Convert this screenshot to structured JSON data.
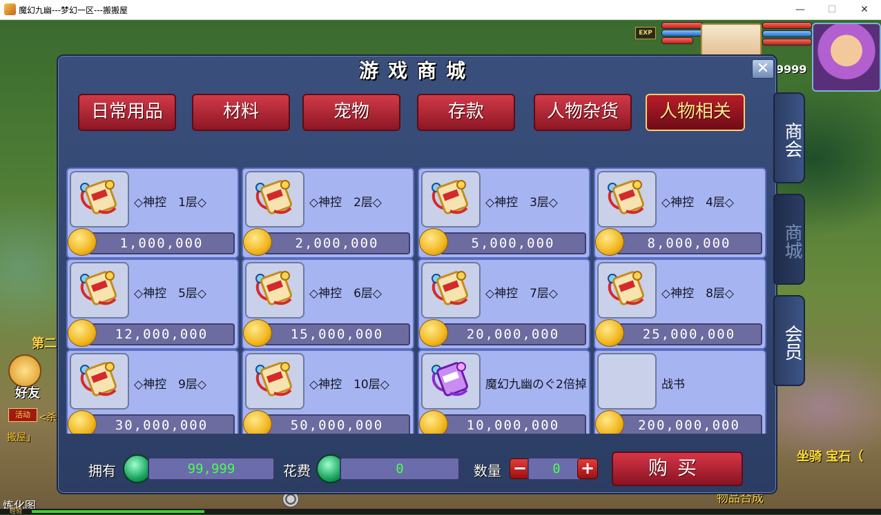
{
  "window": {
    "title": "魔幻九幽---梦幻一区---搬搬屋",
    "minimize_glyph": "—",
    "maximize_glyph": "☐",
    "close_glyph": "✕"
  },
  "hud": {
    "exp_badge": "EXP",
    "gold_count": "9999",
    "left_label": "第二",
    "friend_label": "好友",
    "activity_label": "活动",
    "side_text_1": "<杀",
    "side_text_2": "搬屋」",
    "mount_label": "坐骑 宝石（",
    "map_label": "炼化图",
    "bottom_text": "物品合成",
    "exp_label": "经验"
  },
  "dialog": {
    "title": "游戏商城",
    "close_glyph": "✕",
    "categories": [
      {
        "label": "日常用品"
      },
      {
        "label": "材料"
      },
      {
        "label": "宠物"
      },
      {
        "label": "存款"
      },
      {
        "label": "人物杂货"
      },
      {
        "label": "人物相关"
      }
    ],
    "active_category": "人物相关",
    "partial_row_prices": [
      "20,000,000",
      "25,000,000",
      "30,000,000",
      "50,000,000"
    ],
    "items": [
      {
        "name": "◇神控　1层◇",
        "price": "1,000,000",
        "icon": "scroll-icon"
      },
      {
        "name": "◇神控　2层◇",
        "price": "2,000,000",
        "icon": "scroll-icon"
      },
      {
        "name": "◇神控　3层◇",
        "price": "5,000,000",
        "icon": "scroll-icon"
      },
      {
        "name": "◇神控　4层◇",
        "price": "8,000,000",
        "icon": "scroll-icon"
      },
      {
        "name": "◇神控　5层◇",
        "price": "12,000,000",
        "icon": "scroll-icon"
      },
      {
        "name": "◇神控　6层◇",
        "price": "15,000,000",
        "icon": "scroll-icon"
      },
      {
        "name": "◇神控　7层◇",
        "price": "20,000,000",
        "icon": "scroll-icon"
      },
      {
        "name": "◇神控　8层◇",
        "price": "25,000,000",
        "icon": "scroll-icon"
      },
      {
        "name": "◇神控　9层◇",
        "price": "30,000,000",
        "icon": "scroll-icon"
      },
      {
        "name": "◇神控　10层◇",
        "price": "50,000,000",
        "icon": "scroll-icon"
      },
      {
        "name": "魔幻九幽のぐ2倍掉",
        "price": "10,000,000",
        "icon": "purple-scroll-icon"
      },
      {
        "name": "战书",
        "price": "200,000,000",
        "icon": "empty-slot"
      }
    ],
    "footer": {
      "owned_label": "拥有",
      "owned_value": "99,999",
      "cost_label": "花费",
      "cost_value": "0",
      "quantity_label": "数量",
      "quantity_value": "0",
      "minus_glyph": "−",
      "plus_glyph": "+",
      "buy_label": "购买"
    },
    "side_tabs": [
      {
        "label": "商会"
      },
      {
        "label": "商城"
      },
      {
        "label": "会员"
      }
    ],
    "active_side_tab": "商城"
  }
}
